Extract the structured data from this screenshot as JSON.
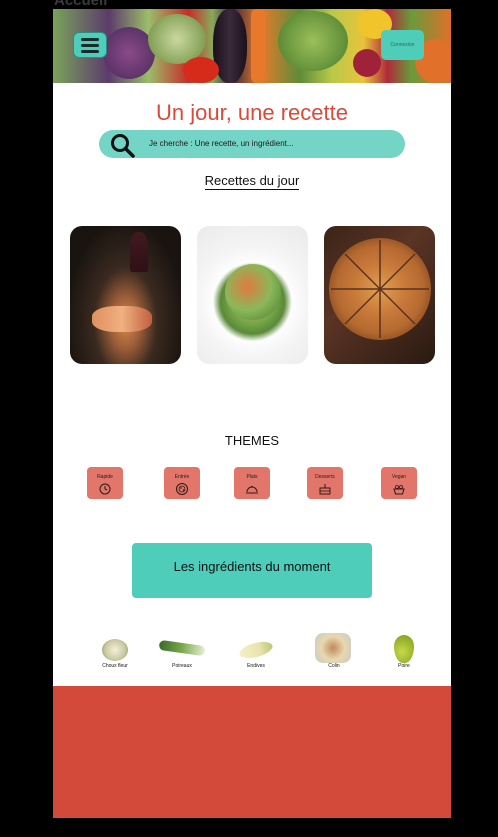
{
  "frame_label": "Accueil",
  "header": {
    "connect_label": "Connexion",
    "menu_icon": "hamburger-menu-icon"
  },
  "title": "Un jour, une recette",
  "search": {
    "placeholder": "Je cherche : Une recette, un ingrédient...",
    "icon": "magnifier-icon"
  },
  "daily": {
    "link_label": "Recettes du jour",
    "recipes": [
      {
        "name": "salmon-dish"
      },
      {
        "name": "salad-bowl"
      },
      {
        "name": "pizza"
      }
    ]
  },
  "themes": {
    "title": "THEMES",
    "items": [
      {
        "label": "Rapide",
        "icon": "clock-dish-icon"
      },
      {
        "label": "Entrée",
        "icon": "pizza-round-icon"
      },
      {
        "label": "Plats",
        "icon": "cloche-plate-icon"
      },
      {
        "label": "Desserts",
        "icon": "cake-icon"
      },
      {
        "label": "Vegan",
        "icon": "vegetable-basket-icon"
      }
    ]
  },
  "cta_label": "Les ingrédients du moment",
  "ingredients": [
    {
      "label": "Choux fleur"
    },
    {
      "label": "Poireaux"
    },
    {
      "label": "Endives"
    },
    {
      "label": "Colin"
    },
    {
      "label": "Poire"
    }
  ],
  "colors": {
    "accent_teal": "#4ecdbb",
    "accent_red": "#d34a3a",
    "theme_tile": "#e2766a",
    "title_red": "#d94a3a"
  }
}
